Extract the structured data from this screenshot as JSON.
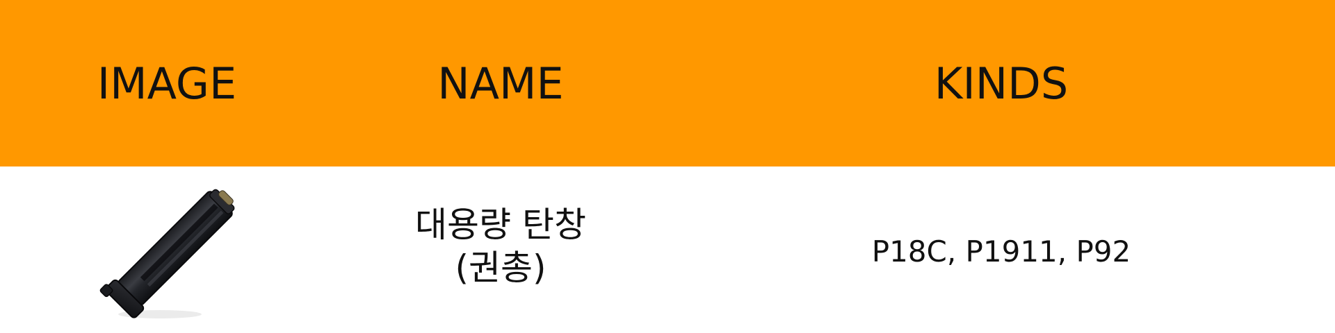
{
  "table": {
    "header": {
      "image_label": "IMAGE",
      "name_label": "NAME",
      "kinds_label": "KINDS"
    },
    "rows": [
      {
        "image_icon": "pistol-magazine-icon",
        "name_line1": "대용량 탄창",
        "name_line2": "(권총)",
        "kinds": "P18C, P1911, P92"
      }
    ]
  },
  "colors": {
    "header_background": "#ff9800",
    "body_background": "#ffffff",
    "text": "#111111"
  }
}
